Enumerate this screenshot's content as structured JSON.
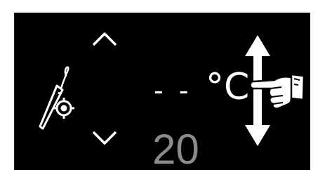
{
  "display": {
    "current_temperature": "- -",
    "unit": "°C",
    "target_temperature": "20"
  },
  "icons": {
    "probe": "meat-probe-icon",
    "increase": "chevron-up-icon",
    "decrease": "chevron-down-icon",
    "gesture": "swipe-vertical-hand-icon"
  },
  "colors": {
    "screen_background": "#000000",
    "text_primary": "#ffffff",
    "text_secondary": "#8a8a8a"
  }
}
